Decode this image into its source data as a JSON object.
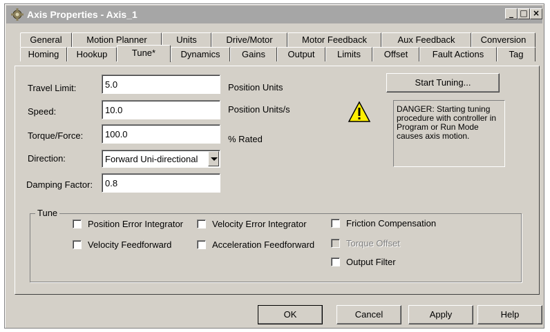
{
  "window": {
    "title": "Axis Properties - Axis_1",
    "controls": [
      "_",
      "□",
      "×"
    ]
  },
  "tabs": {
    "back_row": [
      "General",
      "Motion Planner",
      "Units",
      "Drive/Motor",
      "Motor Feedback",
      "Aux Feedback",
      "Conversion"
    ],
    "front_row": [
      "Homing",
      "Hookup",
      "Tune*",
      "Dynamics",
      "Gains",
      "Output",
      "Limits",
      "Offset",
      "Fault Actions",
      "Tag"
    ],
    "active": "Tune*"
  },
  "form": {
    "travel_limit": {
      "label": "Travel Limit:",
      "value": "5.0",
      "unit": "Position Units"
    },
    "speed": {
      "label": "Speed:",
      "value": "10.0",
      "unit": "Position Units/s"
    },
    "torque": {
      "label": "Torque/Force:",
      "value": "100.0",
      "unit": "% Rated"
    },
    "direction": {
      "label": "Direction:",
      "value": "Forward Uni-directional"
    },
    "damping": {
      "label": "Damping Factor:",
      "value": "0.8"
    }
  },
  "start_tuning_label": "Start Tuning...",
  "warning": {
    "icon": "warning-icon",
    "text": "DANGER: Starting tuning procedure with controller in Program or Run Mode causes axis motion."
  },
  "tune_group": {
    "title": "Tune",
    "options": [
      {
        "label": "Position Error Integrator",
        "checked": false,
        "enabled": true
      },
      {
        "label": "Velocity Feedforward",
        "checked": false,
        "enabled": true
      },
      {
        "label": "Velocity Error Integrator",
        "checked": false,
        "enabled": true
      },
      {
        "label": "Acceleration Feedforward",
        "checked": false,
        "enabled": true
      },
      {
        "label": "Friction Compensation",
        "checked": false,
        "enabled": true
      },
      {
        "label": "Torque Offset",
        "checked": false,
        "enabled": false
      },
      {
        "label": "Output Filter",
        "checked": false,
        "enabled": true
      }
    ]
  },
  "footer": {
    "ok": "OK",
    "cancel": "Cancel",
    "apply": "Apply",
    "help": "Help"
  }
}
